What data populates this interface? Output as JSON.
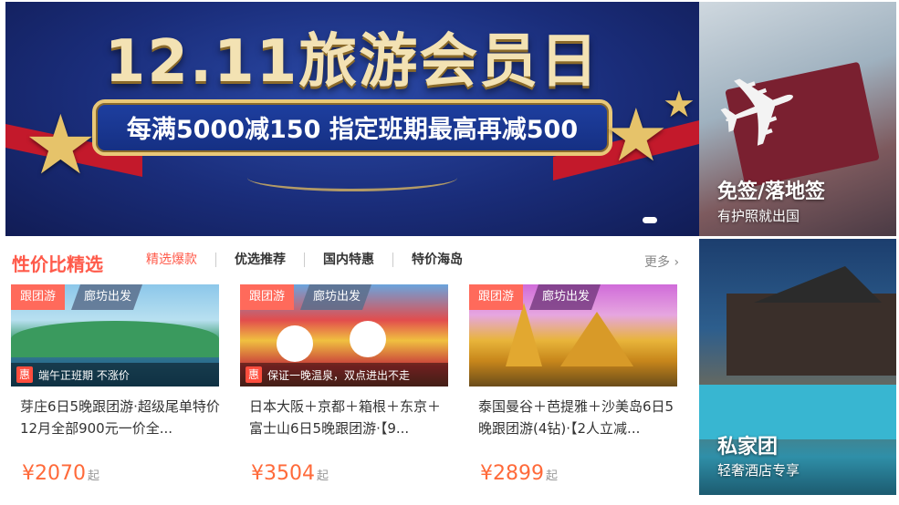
{
  "banner": {
    "title": "12.11旅游会员日",
    "subtitle": "每满5000减150 指定班期最高再减500"
  },
  "promos": [
    {
      "title": "免签/落地签",
      "subtitle": "有护照就出国"
    },
    {
      "title": "私家团",
      "subtitle": "轻奢酒店专享"
    }
  ],
  "section": {
    "title": "性价比精选",
    "tabs": [
      "精选爆款",
      "优选推荐",
      "国内特惠",
      "特价海岛"
    ],
    "more": "更多 ›"
  },
  "cards": [
    {
      "tag_type": "跟团游",
      "tag_depart": "廊坊出发",
      "badge": "惠",
      "promo": "端午正班期 不涨价",
      "desc": "芽庄6日5晚跟团游·超级尾单特价12月全部900元一价全...",
      "price": "¥2070",
      "price_unit": "起"
    },
    {
      "tag_type": "跟团游",
      "tag_depart": "廊坊出发",
      "badge": "惠",
      "promo": "保证一晚温泉，双点进出不走",
      "desc": "日本大阪＋京都＋箱根＋东京＋富士山6日5晚跟团游·【9...",
      "price": "¥3504",
      "price_unit": "起"
    },
    {
      "tag_type": "跟团游",
      "tag_depart": "廊坊出发",
      "badge": "",
      "promo": "",
      "desc": "泰国曼谷＋芭提雅＋沙美岛6日5晚跟团游(4钻)·【2人立减...",
      "price": "¥2899",
      "price_unit": "起"
    }
  ],
  "colors": {
    "accent": "#ff5a4a",
    "price": "#ff6a3a",
    "tag": "#ff6a5b"
  }
}
